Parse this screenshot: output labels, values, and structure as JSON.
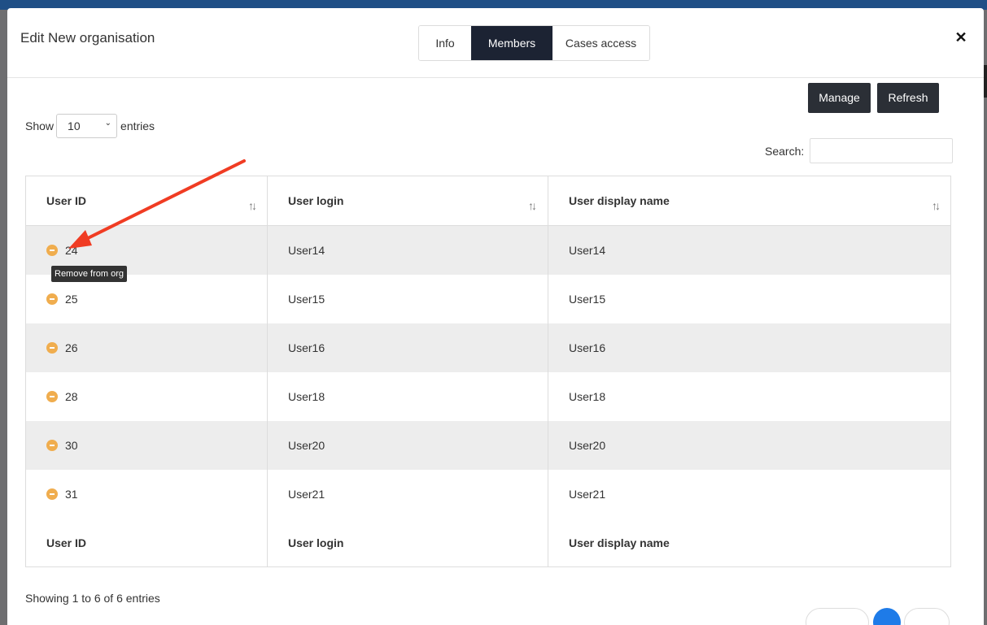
{
  "modal": {
    "title": "Edit New organisation",
    "close_label": "✕"
  },
  "tabs": [
    {
      "label": "Info",
      "active": false
    },
    {
      "label": "Members",
      "active": true
    },
    {
      "label": "Cases access",
      "active": false
    }
  ],
  "toolbar": {
    "manage_label": "Manage",
    "refresh_label": "Refresh"
  },
  "length": {
    "show_label": "Show",
    "value": "10",
    "entries_label": "entries"
  },
  "search": {
    "label": "Search:",
    "value": ""
  },
  "table": {
    "columns": [
      "User ID",
      "User login",
      "User display name"
    ],
    "rows": [
      {
        "id": "24",
        "login": "User14",
        "display": "User14"
      },
      {
        "id": "25",
        "login": "User15",
        "display": "User15"
      },
      {
        "id": "26",
        "login": "User16",
        "display": "User16"
      },
      {
        "id": "28",
        "login": "User18",
        "display": "User18"
      },
      {
        "id": "30",
        "login": "User20",
        "display": "User20"
      },
      {
        "id": "31",
        "login": "User21",
        "display": "User21"
      }
    ],
    "footer_columns": [
      "User ID",
      "User login",
      "User display name"
    ]
  },
  "tooltip": "Remove from org",
  "info_text": "Showing 1 to 6 of 6 entries",
  "colors": {
    "tab_active": "#1c2333",
    "button_dark": "#2b2f36",
    "remove_icon": "#f0ad4e",
    "arrow": "#f03c23",
    "page_active": "#1e7be8"
  }
}
